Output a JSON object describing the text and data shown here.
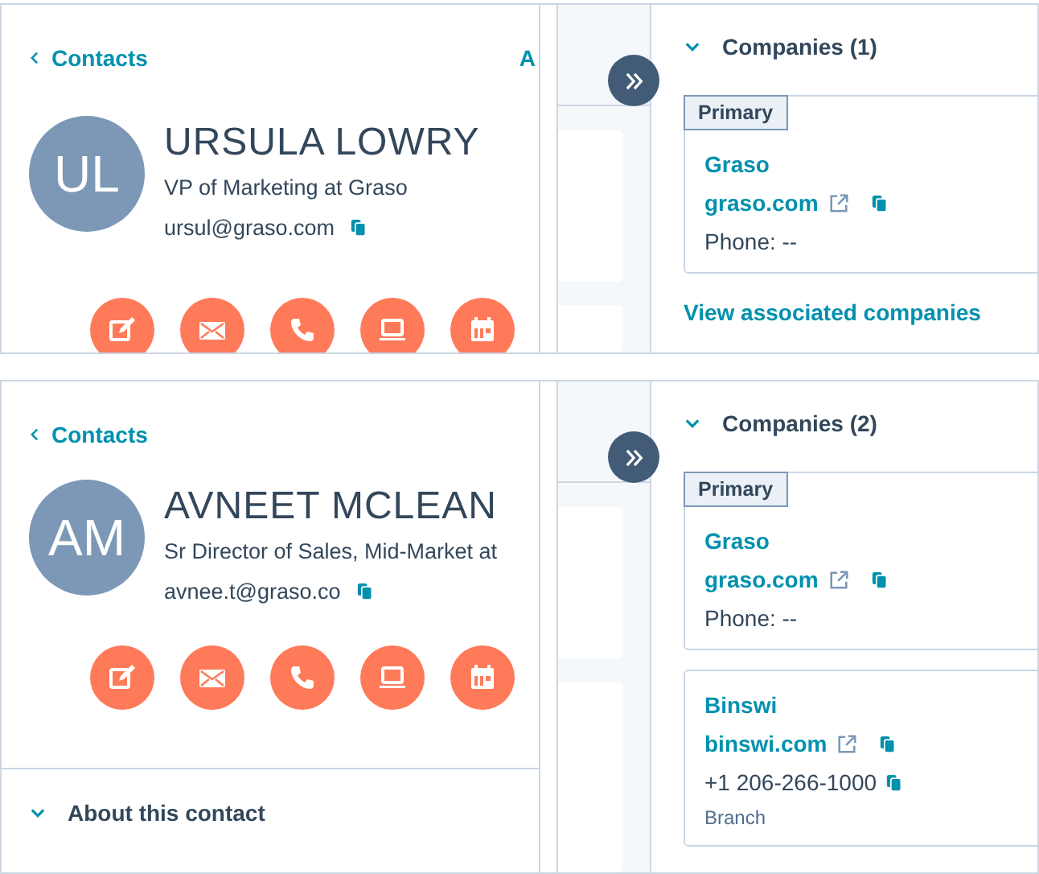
{
  "records": [
    {
      "back_link": "Contacts",
      "cut_tab": "A",
      "initials": "UL",
      "name": "URSULA LOWRY",
      "title": "VP of Marketing at Graso",
      "email": "ursul@graso.com",
      "actions": [
        {
          "kind": "note"
        },
        {
          "kind": "email"
        },
        {
          "kind": "call"
        },
        {
          "kind": "task"
        },
        {
          "kind": "meeting"
        }
      ],
      "companies_header": "Companies (1)",
      "companies": [
        {
          "badge": "Primary",
          "name": "Graso",
          "domain": "graso.com",
          "phone": "Phone: --",
          "phone_copyable": false
        }
      ],
      "view_link": "View associated companies"
    },
    {
      "back_link": "Contacts",
      "initials": "AM",
      "name": "AVNEET MCLEAN",
      "title": "Sr Director of Sales, Mid-Market at",
      "email": "avnee.t@graso.co",
      "actions": [
        {
          "kind": "note"
        },
        {
          "kind": "email"
        },
        {
          "kind": "call"
        },
        {
          "kind": "task"
        },
        {
          "kind": "meeting"
        }
      ],
      "about_section": "About this contact",
      "companies_header": "Companies (2)",
      "companies": [
        {
          "badge": "Primary",
          "name": "Graso",
          "domain": "graso.com",
          "phone": "Phone: --",
          "phone_copyable": false
        },
        {
          "name": "Binswi",
          "domain": "binswi.com",
          "phone": "+1 206-266-1000",
          "phone_copyable": true,
          "note": "Branch"
        }
      ]
    }
  ]
}
